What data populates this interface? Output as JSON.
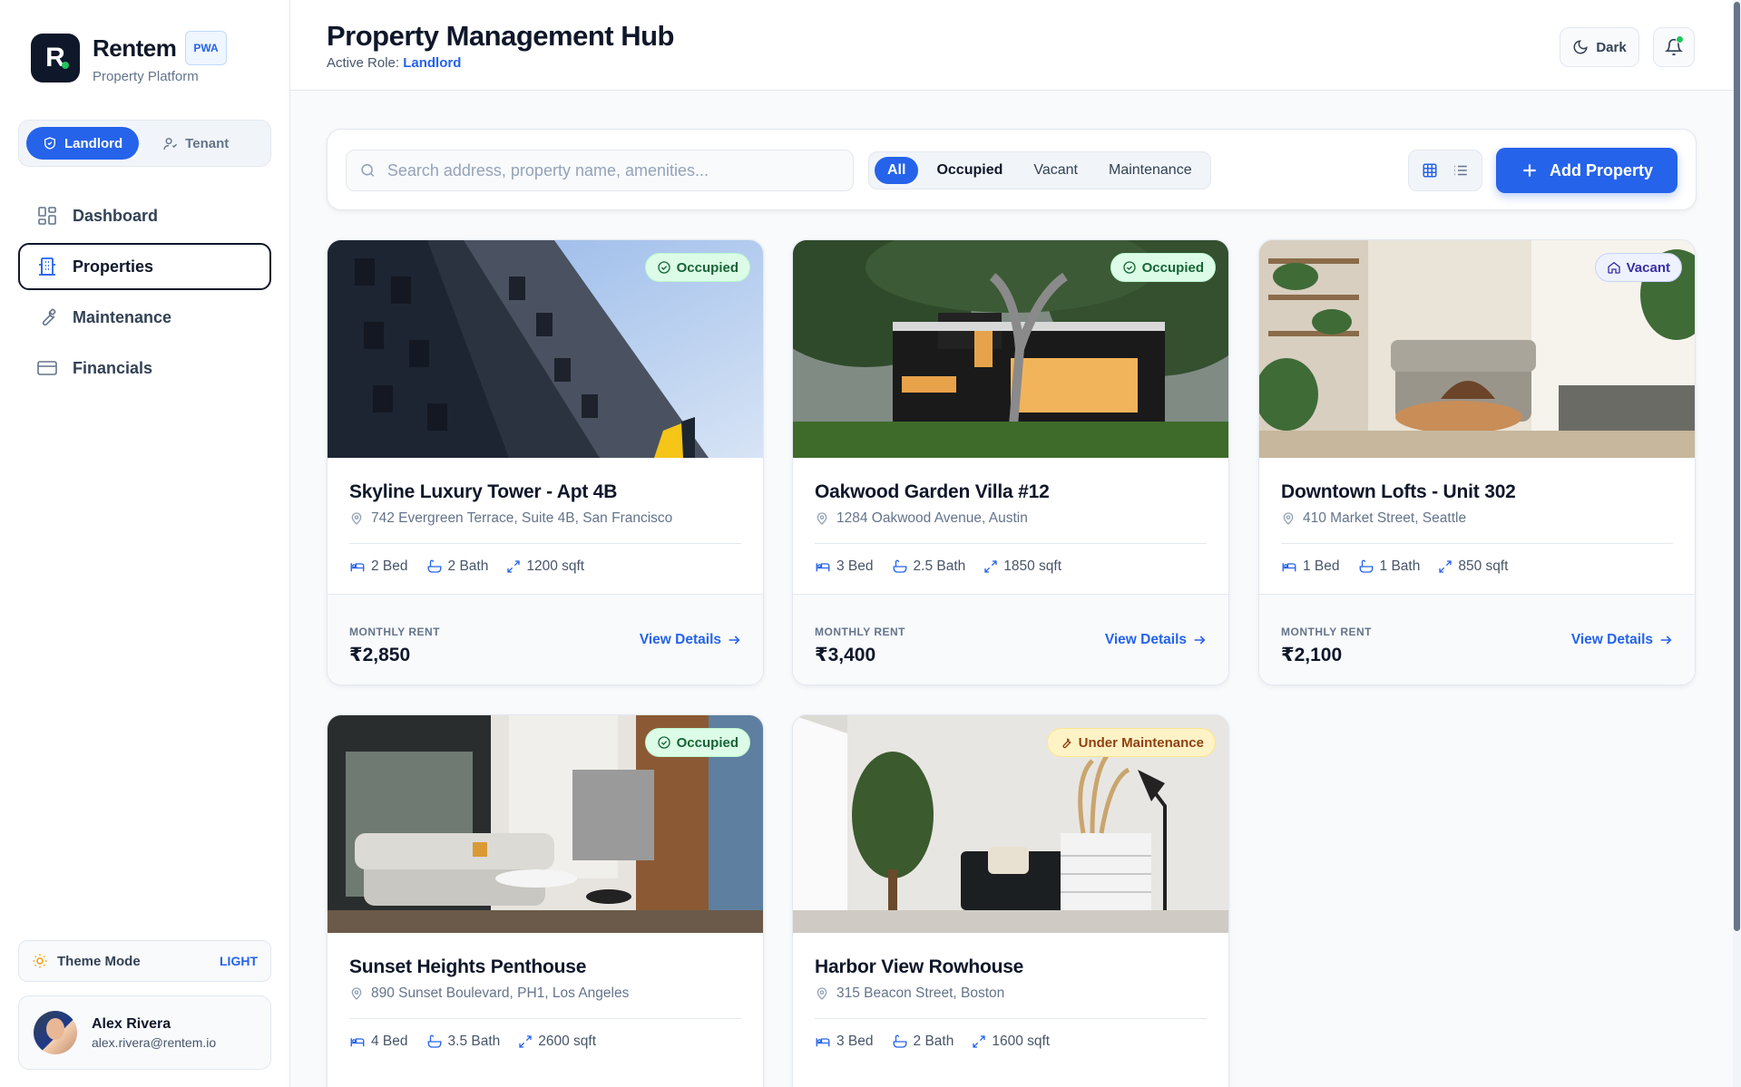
{
  "brand": {
    "logo_letter": "R",
    "name": "Rentem",
    "badge": "PWA",
    "subtitle": "Property Platform"
  },
  "roles": {
    "landlord": "Landlord",
    "tenant": "Tenant",
    "active": "Landlord"
  },
  "nav": [
    {
      "label": "Dashboard",
      "icon": "dashboard-icon"
    },
    {
      "label": "Properties",
      "icon": "building-icon",
      "active": true
    },
    {
      "label": "Maintenance",
      "icon": "wrench-icon"
    },
    {
      "label": "Financials",
      "icon": "credit-card-icon"
    }
  ],
  "theme": {
    "label": "Theme Mode",
    "mode": "LIGHT"
  },
  "user": {
    "name": "Alex Rivera",
    "email": "alex.rivera@rentem.io"
  },
  "header": {
    "title": "Property Management Hub",
    "role_prefix": "Active Role:",
    "role_value": "Landlord",
    "dark_label": "Dark"
  },
  "toolbar": {
    "search_placeholder": "Search address, property name, amenities...",
    "search_value": "",
    "filters": [
      "All",
      "Occupied",
      "Vacant",
      "Maintenance"
    ],
    "active_filter": "All",
    "add_label": "Add Property"
  },
  "cards": [
    {
      "title": "Skyline Luxury Tower - Apt 4B",
      "address": "742 Evergreen Terrace, Suite 4B, San Francisco",
      "status": "Occupied",
      "bed": "2 Bed",
      "bath": "2 Bath",
      "area": "1200 sqft",
      "rent_label": "MONTHLY RENT",
      "rent": "₹2,850",
      "link": "View Details"
    },
    {
      "title": "Oakwood Garden Villa #12",
      "address": "1284 Oakwood Avenue, Austin",
      "status": "Occupied",
      "bed": "3 Bed",
      "bath": "2.5 Bath",
      "area": "1850 sqft",
      "rent_label": "MONTHLY RENT",
      "rent": "₹3,400",
      "link": "View Details"
    },
    {
      "title": "Downtown Lofts - Unit 302",
      "address": "410 Market Street, Seattle",
      "status": "Vacant",
      "bed": "1 Bed",
      "bath": "1 Bath",
      "area": "850 sqft",
      "rent_label": "MONTHLY RENT",
      "rent": "₹2,100",
      "link": "View Details"
    },
    {
      "title": "Sunset Heights Penthouse",
      "address": "890 Sunset Boulevard, PH1, Los Angeles",
      "status": "Occupied",
      "bed": "4 Bed",
      "bath": "3.5 Bath",
      "area": "2600 sqft"
    },
    {
      "title": "Harbor View Rowhouse",
      "address": "315 Beacon Street, Boston",
      "status": "Under Maintenance",
      "bed": "3 Bed",
      "bath": "2 Bath",
      "area": "1600 sqft"
    }
  ],
  "colors": {
    "accent": "#2563eb",
    "occupied": "#166534",
    "vacant": "#3730a3",
    "maintenance": "#92400e",
    "online": "#22c55e"
  }
}
